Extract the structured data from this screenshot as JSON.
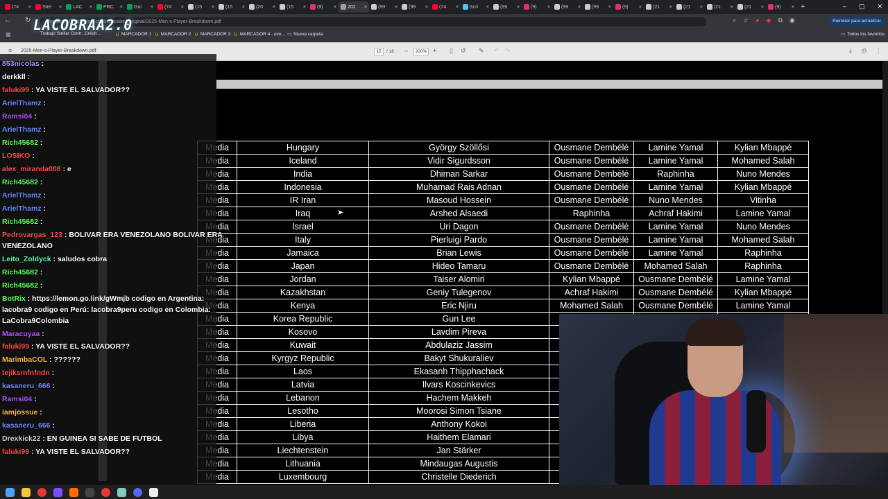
{
  "browser": {
    "tabs": [
      {
        "label": "(74",
        "color": "#ff0033"
      },
      {
        "label": "Stre",
        "color": "#ff0033"
      },
      {
        "label": "LAC",
        "color": "#0f9d58"
      },
      {
        "label": "PRC",
        "color": "#0f9d58"
      },
      {
        "label": "Gui",
        "color": "#0f9d58"
      },
      {
        "label": "(74",
        "color": "#ff0033"
      },
      {
        "label": "(15",
        "color": "#cccccc"
      },
      {
        "label": "(15",
        "color": "#cccccc"
      },
      {
        "label": "(20",
        "color": "#cccccc"
      },
      {
        "label": "(15",
        "color": "#cccccc"
      },
      {
        "label": "(9)",
        "color": "#e1306c"
      },
      {
        "label": "202",
        "color": "#9aa0a6",
        "active": true
      },
      {
        "label": "(99",
        "color": "#cccccc"
      },
      {
        "label": "(99",
        "color": "#cccccc"
      },
      {
        "label": "(74",
        "color": "#ff0033"
      },
      {
        "label": "Scri",
        "color": "#4fc3f7"
      },
      {
        "label": "(99",
        "color": "#cccccc"
      },
      {
        "label": "(9)",
        "color": "#e1306c"
      },
      {
        "label": "(99",
        "color": "#cccccc"
      },
      {
        "label": "(99",
        "color": "#cccccc"
      },
      {
        "label": "(9)",
        "color": "#e1306c"
      },
      {
        "label": "(21",
        "color": "#cccccc"
      },
      {
        "label": "(21",
        "color": "#cccccc"
      },
      {
        "label": "(21",
        "color": "#cccccc"
      },
      {
        "label": "(21",
        "color": "#cccccc"
      },
      {
        "label": "(9)",
        "color": "#e1306c"
      }
    ],
    "new_tab": "+",
    "url": "digitalhub.fifa.com/m/4cd05edacabe1/original/2025-Men-s-Player-Breakdown.pdf",
    "update_button": "Reiniciar para actualizar",
    "bookmarks": [
      {
        "label": "Trabajo Stellar Contr..."
      },
      {
        "label": "Crédit ..."
      },
      {
        "label": "MARCADOR 1"
      },
      {
        "label": "MARCADOR 2"
      },
      {
        "label": "MARCADOR 3"
      },
      {
        "label": "MARCADOR 4 - ove..."
      },
      {
        "label": "Nueva carpeta"
      }
    ],
    "all_favorites": "Todos los favoritos"
  },
  "overlay_logo": "LACOBRAA2.0",
  "pdf": {
    "filename": "2025-Men-s-Player-Breakdown.pdf",
    "page_current": "15",
    "page_total": "/ 18",
    "zoom": "200%",
    "rows": [
      [
        "Media",
        "Hungary",
        "György Szöllősi",
        "Ousmane Dembélé",
        "Lamine Yamal",
        "Kylian Mbappé"
      ],
      [
        "Media",
        "Iceland",
        "Vidir Sigurdsson",
        "Ousmane Dembélé",
        "Lamine Yamal",
        "Mohamed Salah"
      ],
      [
        "Media",
        "India",
        "Dhiman Sarkar",
        "Ousmane Dembélé",
        "Raphinha",
        "Nuno Mendes"
      ],
      [
        "Media",
        "Indonesia",
        "Muhamad Rais Adnan",
        "Ousmane Dembélé",
        "Lamine Yamal",
        "Kylian Mbappé"
      ],
      [
        "Media",
        "IR Iran",
        "Masoud Hossein",
        "Ousmane Dembélé",
        "Nuno Mendes",
        "Vitinha"
      ],
      [
        "Media",
        "Iraq",
        "Arshed Alsaedi",
        "Raphinha",
        "Achraf Hakimi",
        "Lamine Yamal"
      ],
      [
        "Media",
        "Israel",
        "Uri Dagon",
        "Ousmane Dembélé",
        "Lamine Yamal",
        "Nuno Mendes"
      ],
      [
        "Media",
        "Italy",
        "Pierluigi Pardo",
        "Ousmane Dembélé",
        "Lamine Yamal",
        "Mohamed Salah"
      ],
      [
        "Media",
        "Jamaica",
        "Brian Lewis",
        "Ousmane Dembélé",
        "Lamine Yamal",
        "Raphinha"
      ],
      [
        "Media",
        "Japan",
        "Hideo Tamaru",
        "Ousmane Dembélé",
        "Mohamed Salah",
        "Raphinha"
      ],
      [
        "Media",
        "Jordan",
        "Taiser Alomiri",
        "Kylian Mbappé",
        "Ousmane Dembélé",
        "Lamine Yamal"
      ],
      [
        "Media",
        "Kazakhstan",
        "Geniy Tulegenov",
        "Achraf Hakimi",
        "Ousmane Dembélé",
        "Kylian Mbappé"
      ],
      [
        "Media",
        "Kenya",
        "Eric Njiru",
        "Mohamed Salah",
        "Ousmane Dembélé",
        "Lamine Yamal"
      ],
      [
        "Media",
        "Korea Republic",
        "Gun Lee",
        "Ou",
        "",
        ""
      ],
      [
        "Media",
        "Kosovo",
        "Lavdim Pireva",
        "Ou",
        "",
        ""
      ],
      [
        "Media",
        "Kuwait",
        "Abdulaziz Jassim",
        "Ou",
        "",
        ""
      ],
      [
        "Media",
        "Kyrgyz Republic",
        "Bakyt Shukuraliev",
        "",
        "",
        ""
      ],
      [
        "Media",
        "Laos",
        "Ekasanh Thipphachack",
        "O",
        "",
        ""
      ],
      [
        "Media",
        "Latvia",
        "Ilvars Koscinkevics",
        "",
        "",
        ""
      ],
      [
        "Media",
        "Lebanon",
        "Hachem Makkeh",
        "I",
        "",
        ""
      ],
      [
        "Media",
        "Lesotho",
        "Moorosi Simon Tsiane",
        "Ou",
        "",
        ""
      ],
      [
        "Media",
        "Liberia",
        "Anthony Kokoi",
        "",
        "",
        ""
      ],
      [
        "Media",
        "Libya",
        "Haithem Elamari",
        "",
        "",
        ""
      ],
      [
        "Media",
        "Liechtenstein",
        "Jan Stärker",
        "",
        "",
        ""
      ],
      [
        "Media",
        "Lithuania",
        "Mindaugas Augustis",
        "O",
        "",
        ""
      ],
      [
        "Media",
        "Luxembourg",
        "Christelle Diederich",
        "",
        "",
        ""
      ]
    ]
  },
  "chat": [
    {
      "user": "853nicolas",
      "color": "#b48cff",
      "msg": ":"
    },
    {
      "user": "derkkll",
      "color": "#ffffff",
      "msg": ":"
    },
    {
      "user": "faluki99",
      "color": "#ff4d4d",
      "msg": ": YA VISTE EL SALVADOR??"
    },
    {
      "user": "ArielThamz",
      "color": "#6f8cff",
      "msg": ":"
    },
    {
      "user": "Ramsi04",
      "color": "#b455ff",
      "msg": ":"
    },
    {
      "user": "ArielThamz",
      "color": "#6f8cff",
      "msg": ":"
    },
    {
      "user": "Rich45682",
      "color": "#5dff5d",
      "msg": ":"
    },
    {
      "user": "LOSIKO",
      "color": "#ff4d4d",
      "msg": ":"
    },
    {
      "user": "alex_miranda008",
      "color": "#ff4d4d",
      "msg": ": e"
    },
    {
      "user": "Rich45682",
      "color": "#5dff5d",
      "msg": ":"
    },
    {
      "user": "ArielThamz",
      "color": "#6f8cff",
      "msg": ":"
    },
    {
      "user": "ArielThamz",
      "color": "#6f8cff",
      "msg": ":"
    },
    {
      "user": "Rich45682",
      "color": "#5dff5d",
      "msg": ":"
    },
    {
      "user": "Pedrovargas_123",
      "color": "#ff4d4d",
      "msg": ": BOLIVAR ERA VENEZOLANO BOLIVAR ERA"
    },
    {
      "user": "",
      "color": "#ffffff",
      "msg": "VENEZOLANO"
    },
    {
      "user": "Leito_Zoldyck",
      "color": "#5dffb0",
      "msg": ": saludos cobra"
    },
    {
      "user": "Rich45682",
      "color": "#5dff5d",
      "msg": ":"
    },
    {
      "user": "Rich45682",
      "color": "#5dff5d",
      "msg": ":"
    },
    {
      "user": "BotRix",
      "color": "#5dff5d",
      "msg": ": https://lemon.go.link/gWmjb codigo en Argentina:"
    },
    {
      "user": "",
      "color": "#ffffff",
      "msg": "lacobra9 codigo en Perú: lacobra9peru codigo en Colombia:"
    },
    {
      "user": "",
      "color": "#ffffff",
      "msg": "LaCobra9Colombia"
    },
    {
      "user": "Maracuyaa",
      "color": "#b455ff",
      "msg": ":"
    },
    {
      "user": "faluki99",
      "color": "#ff4d4d",
      "msg": ": YA VISTE EL SALVADOR??"
    },
    {
      "user": "MarimbaCOL",
      "color": "#ffb84d",
      "msg": ": ??????"
    },
    {
      "user": "tejiksmfnfndn",
      "color": "#ff4d4d",
      "msg": ":"
    },
    {
      "user": "kasaneru_666",
      "color": "#6f8cff",
      "msg": ":"
    },
    {
      "user": "Ramsi04",
      "color": "#b455ff",
      "msg": ":"
    },
    {
      "user": "iamjossue",
      "color": "#ffb84d",
      "msg": ":"
    },
    {
      "user": "kasaneru_666",
      "color": "#6f8cff",
      "msg": ":"
    },
    {
      "user": "Drexkick22",
      "color": "#cfcfcf",
      "msg": ": EN GUINEA SI SABE DE FUTBOL"
    },
    {
      "user": "faluki99",
      "color": "#ff4d4d",
      "msg": ": YA VISTE EL SALVADOR??"
    }
  ],
  "colors": {
    "chrome_dark": "#202124",
    "pdf_toolbar": "#e9e9e9",
    "table_border": "#ffffff"
  }
}
